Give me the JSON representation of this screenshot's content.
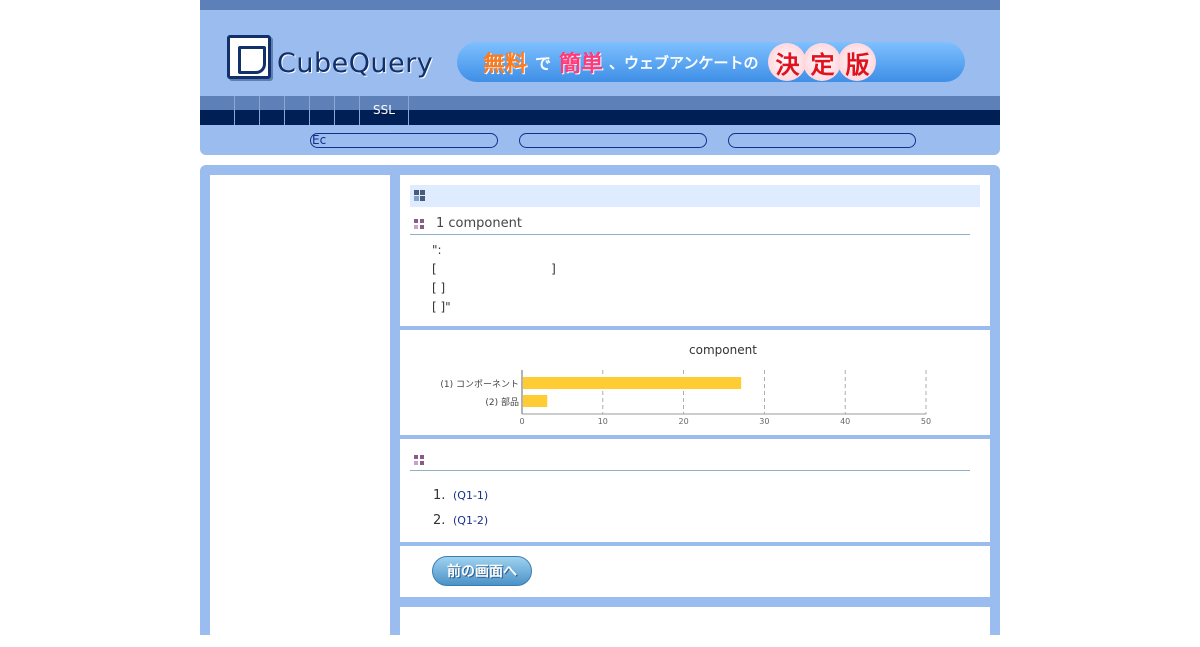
{
  "header": {
    "logo_text": "CubeQuery",
    "banner": {
      "part1": "無料",
      "part2": "で",
      "part3": "簡単",
      "part4": "、ウェブアンケートの",
      "stamps": [
        "決",
        "定",
        "版"
      ]
    },
    "nav": {
      "ssl_label": "SSL"
    },
    "pills": [
      {
        "label": "Ec"
      },
      {
        "label": ""
      },
      {
        "label": ""
      }
    ]
  },
  "section1": {
    "title": "1 component",
    "lines": [
      "\":",
      "[                              ]",
      "[ ]",
      "[ ]\""
    ]
  },
  "chart_data": {
    "type": "bar",
    "title": "component",
    "categories": [
      "(1) コンポーネント",
      "(2) 部品"
    ],
    "values": [
      27,
      3
    ],
    "xlim": [
      0,
      50
    ],
    "xticks": [
      0,
      10,
      20,
      30,
      40,
      50
    ],
    "grid": true,
    "color": "#ffcc33",
    "orientation": "horizontal"
  },
  "section3": {
    "items": [
      {
        "num": "1.",
        "link": "(Q1-1)"
      },
      {
        "num": "2.",
        "link": "(Q1-2)"
      }
    ]
  },
  "back_button": {
    "label": "前の画面へ"
  },
  "colors": {
    "frame": "#9bbcee",
    "navbar": "#5e80b8",
    "navbar_dark": "#001f55",
    "accent_link": "#1a2f8a"
  }
}
